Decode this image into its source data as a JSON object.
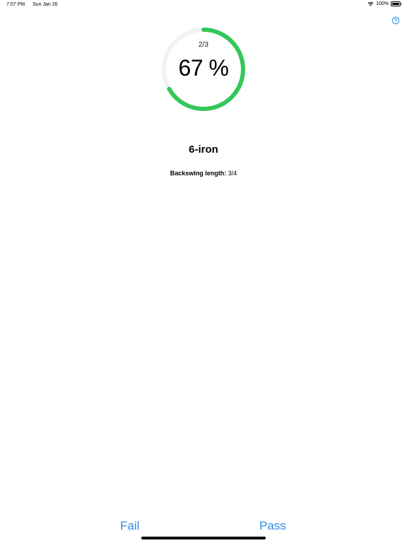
{
  "status_bar": {
    "time": "7:07 PM",
    "date": "Sun Jan 26",
    "battery_text": "100%",
    "battery_level": 1.0
  },
  "help": {
    "icon": "help-circle-icon"
  },
  "progress": {
    "count_text": "2/3",
    "percent_text": "67 %",
    "fraction": 0.6667,
    "ring_color": "#34c759",
    "track_color": "#f2f2f2"
  },
  "club": {
    "name": "6-iron"
  },
  "detail": {
    "label": "Backswing length:",
    "value": "3/4"
  },
  "actions": {
    "fail_label": "Fail",
    "pass_label": "Pass",
    "accent_color": "#2f8ce6"
  }
}
